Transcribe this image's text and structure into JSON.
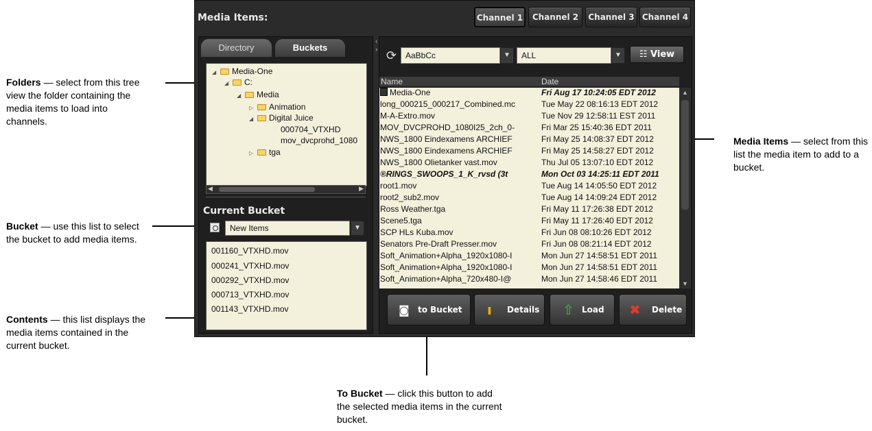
{
  "callouts": {
    "folders": {
      "title": "Folders",
      "text": " — select from this tree view the folder containing the media items to load into channels."
    },
    "bucket": {
      "title": "Bucket",
      "text": " — use this list to select the bucket to add media items."
    },
    "contents": {
      "title": "Contents",
      "text": " — this list displays the media items contained in the current bucket."
    },
    "media_items": {
      "title": "Media Items",
      "text": " — select from this list the media item to add to a bucket."
    },
    "to_bucket": {
      "title": "To Bucket",
      "text": " — click this button to add the selected media items in the current bucket."
    }
  },
  "app": {
    "title": "Media Items:",
    "channels": [
      "Channel 1",
      "Channel 2",
      "Channel 3",
      "Channel 4"
    ],
    "active_channel": "Channel 1"
  },
  "left": {
    "tabs": {
      "directory": "Directory",
      "buckets": "Buckets"
    },
    "tree": [
      "Media-One",
      "C:",
      "Media",
      "Animation",
      "Digital Juice",
      "000704_VTXHD",
      "mov_dvcprohd_1080",
      "tga"
    ],
    "current_bucket_title": "Current Bucket",
    "bucket_value": "New Items",
    "contents": [
      "001160_VTXHD.mov",
      "000241_VTXHD.mov",
      "000292_VTXHD.mov",
      "000713_VTXHD.mov",
      "001143_VTXHD.mov"
    ]
  },
  "right": {
    "filter_text": "AaBbCc",
    "filter_type": "ALL",
    "view_label": "View",
    "columns": {
      "name": "Name",
      "date": "Date"
    },
    "items": [
      {
        "name": "Media-One",
        "date": "Fri Aug 17 10:24:05 EDT 2012"
      },
      {
        "name": "long_000215_000217_Combined.mc",
        "date": "Tue May 22 08:16:13 EDT 2012"
      },
      {
        "name": "M-A-Extro.mov",
        "date": "Tue Nov 29 12:58:11 EST 2011"
      },
      {
        "name": "MOV_DVCPROHD_1080I25_2ch_0-",
        "date": "Fri Mar 25 15:40:36 EDT 2011"
      },
      {
        "name": "NWS_1800 Eindexamens ARCHIEF",
        "date": "Fri May 25 14:08:37 EDT 2012"
      },
      {
        "name": "NWS_1800 Eindexamens ARCHIEF",
        "date": "Fri May 25 14:58:27 EDT 2012"
      },
      {
        "name": "NWS_1800 Olietanker vast.mov",
        "date": "Thu Jul 05 13:07:10 EDT 2012"
      },
      {
        "name": "RINGS_SWOOPS_1_K_rvsd (3t",
        "date": "Mon Oct 03 14:25:11 EDT 2011"
      },
      {
        "name": "root1.mov",
        "date": "Tue Aug 14 14:05:50 EDT 2012"
      },
      {
        "name": "root2_sub2.mov",
        "date": "Tue Aug 14 14:09:24 EDT 2012"
      },
      {
        "name": "Ross Weather.tga",
        "date": "Fri May 11 17:26:38 EDT 2012"
      },
      {
        "name": "Scene5.tga",
        "date": "Fri May 11 17:26:40 EDT 2012"
      },
      {
        "name": "SCP HLs Kuba.mov",
        "date": "Fri Jun 08 08:10:26 EDT 2012"
      },
      {
        "name": "Senators Pre-Draft Presser.mov",
        "date": "Fri Jun 08 08:21:14 EDT 2012"
      },
      {
        "name": "Soft_Animation+Alpha_1920x1080-I",
        "date": "Mon Jun 27 14:58:51 EDT 2011"
      },
      {
        "name": "Soft_Animation+Alpha_1920x1080-I",
        "date": "Mon Jun 27 14:58:51 EDT 2011"
      },
      {
        "name": "Soft_Animation+Alpha_720x480-I@",
        "date": "Mon Jun 27 14:58:46 EDT 2011"
      }
    ],
    "buttons": {
      "to_bucket": "to Bucket",
      "details": "Details",
      "load": "Load",
      "delete": "Delete"
    }
  }
}
